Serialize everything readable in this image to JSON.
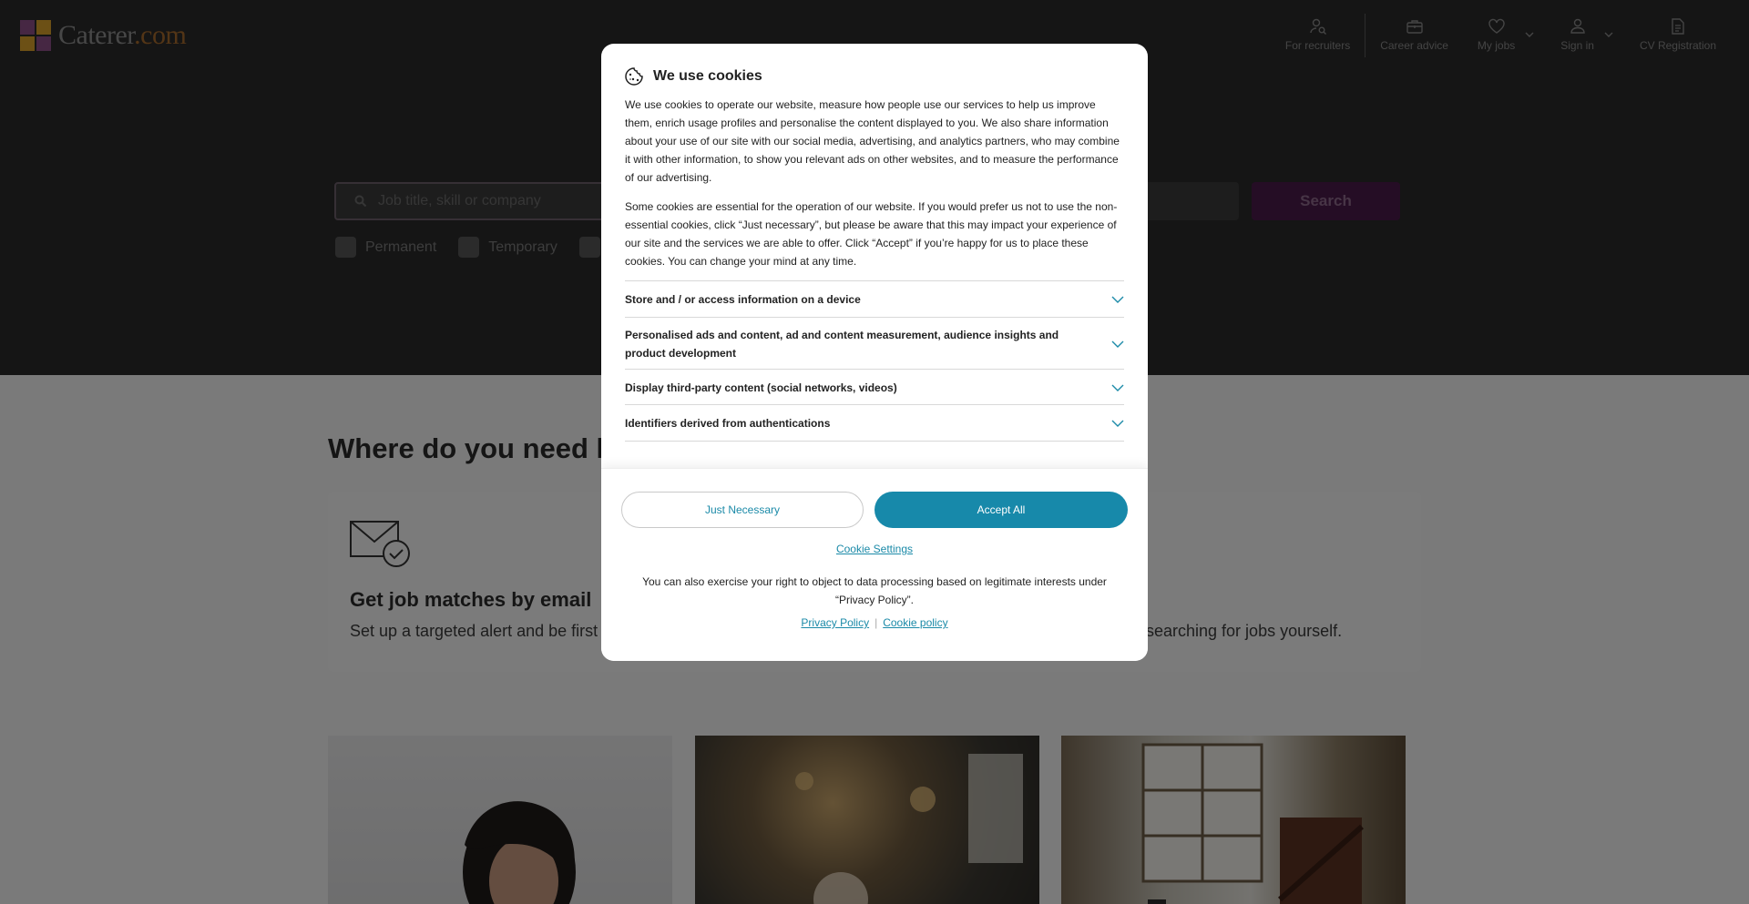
{
  "header": {
    "logo_main": "Caterer",
    "logo_domain": ".com",
    "nav": {
      "recruiters": "For recruiters",
      "career_advice": "Career advice",
      "my_jobs": "My jobs",
      "sign_in": "Sign in",
      "cv_registration": "CV Registration"
    }
  },
  "search": {
    "keyword_placeholder": "Job title, skill or company",
    "location_placeholder": "",
    "button_label": "Search",
    "filters": [
      "Permanent",
      "Temporary"
    ]
  },
  "content": {
    "section_title": "Where do you need h",
    "promo": {
      "title": "Get job matches by email",
      "description": "Set up a targeted alert and be first",
      "description_right": "f searching for jobs yourself."
    }
  },
  "cookie_modal": {
    "title": "We use cookies",
    "paragraph1": "We use cookies to operate our website, measure how people use our services to help us improve them, enrich usage profiles and personalise the content displayed to you. We also share information about your use of our site with our social media, advertising, and analytics partners, who may combine it with other information, to show you relevant ads on other websites, and to measure the performance of our advertising.",
    "paragraph2": "Some cookies are essential for the operation of our website. If you would prefer us not to use the non-essential cookies, click “Just necessary”, but please be aware that this may impact your experience of our site and the services we are able to offer. Click “Accept” if you’re happy for us to place these cookies. You can change your mind at any time.",
    "purposes": [
      "Store and / or access information on a device",
      "Personalised ads and content, ad and content measurement, audience insights and product development",
      "Display third-party content (social networks, videos)",
      "Identifiers derived from authentications"
    ],
    "btn_necessary": "Just Necessary",
    "btn_accept": "Accept All",
    "link_settings": "Cookie Settings",
    "object_text": "You can also exercise your right to object to data processing based on legitimate interests under “Privacy Policy”.",
    "privacy_policy": "Privacy Policy",
    "cookie_policy": "Cookie policy"
  },
  "colors": {
    "accent": "#1789aa",
    "hero": "#2b2b2b",
    "search_button": "#4b1a4a"
  }
}
